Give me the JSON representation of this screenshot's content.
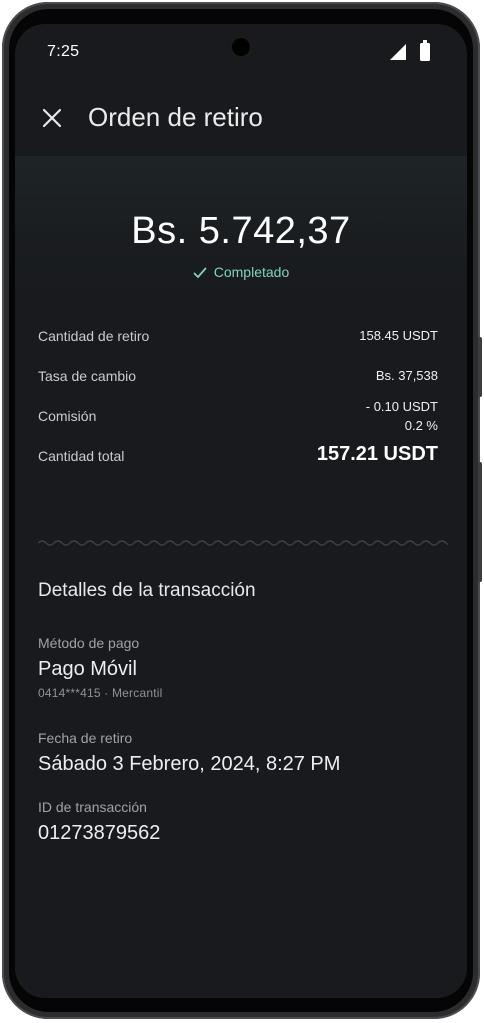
{
  "status_bar": {
    "time": "7:25"
  },
  "header": {
    "title": "Orden de retiro"
  },
  "hero": {
    "amount": "Bs. 5.742,37",
    "status": "Completado",
    "status_color": "#7fd3bf"
  },
  "summary": {
    "withdraw_label": "Cantidad de retiro",
    "withdraw_value": "158.45 USDT",
    "rate_label": "Tasa de cambio",
    "rate_value": "Bs. 37,538",
    "fee_label": "Comisión",
    "fee_value": "- 0.10 USDT",
    "fee_percent": "0.2 %",
    "total_label": "Cantidad total",
    "total_value": "157.21 USDT"
  },
  "details": {
    "section_title": "Detalles de la transacción",
    "payment_method_label": "Método de pago",
    "payment_method_value": "Pago Móvil",
    "payment_method_sub": "0414***415 · Mercantil",
    "date_label": "Fecha de retiro",
    "date_value": "Sábado 3 Febrero, 2024, 8:27 PM",
    "tx_id_label": "ID de transacción",
    "tx_id_value": "01273879562"
  },
  "icons": {
    "close": "close-icon",
    "check": "check-icon",
    "signal": "signal-icon",
    "battery": "battery-icon"
  },
  "colors": {
    "background": "#181a1d",
    "accent": "#7fd3bf"
  }
}
